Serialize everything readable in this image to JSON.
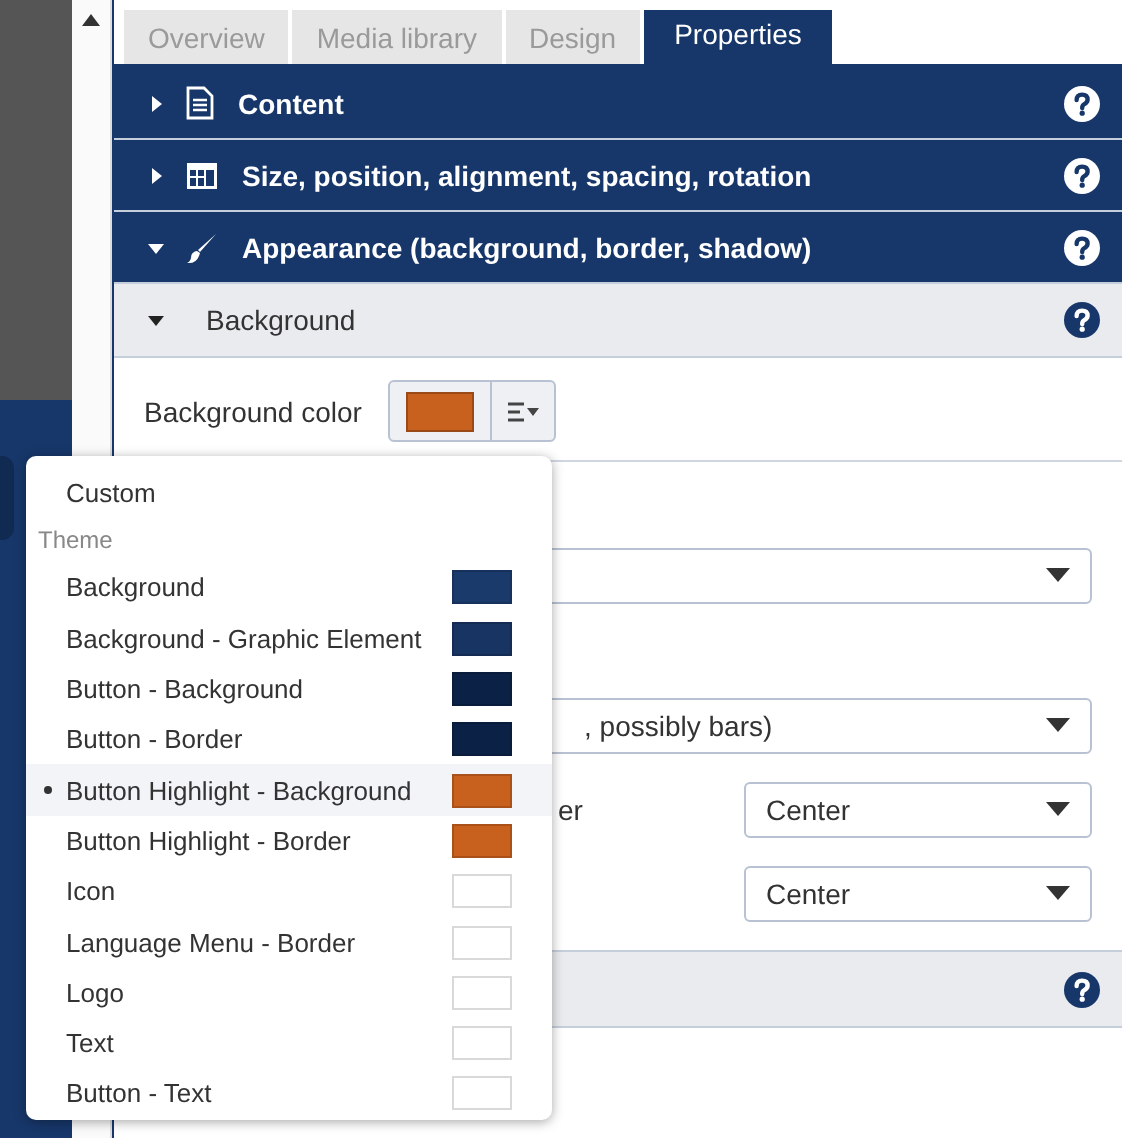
{
  "tabs": [
    {
      "label": "Overview",
      "selected": false
    },
    {
      "label": "Media library",
      "selected": false
    },
    {
      "label": "Design",
      "selected": false
    },
    {
      "label": "Properties",
      "selected": true
    }
  ],
  "sections": [
    {
      "label": "Content",
      "kind": "document",
      "expanded": false
    },
    {
      "label": "Size, position, alignment, spacing, rotation",
      "kind": "grid",
      "expanded": false
    },
    {
      "label": "Appearance (background, border, shadow)",
      "kind": "brush",
      "expanded": true
    }
  ],
  "subsection": {
    "label": "Background",
    "expanded": true
  },
  "background_color": {
    "label": "Background color",
    "color": "#c8601e"
  },
  "fields": [
    {
      "kind": "select"
    },
    {
      "kind": "select",
      "value": ", possibly bars)"
    },
    {
      "kind": "labeled_select",
      "label": "er",
      "value": "Center"
    },
    {
      "kind": "labeled_select",
      "value": "Center"
    }
  ],
  "color_menu": {
    "items": [
      {
        "kind": "option",
        "label": "Custom",
        "selected": false
      },
      {
        "kind": "heading",
        "label": "Theme"
      },
      {
        "kind": "color",
        "label": "Background",
        "color": "#1b3a6c",
        "selected": false
      },
      {
        "kind": "color",
        "label": "Background - Graphic Element",
        "color": "#183463",
        "selected": false
      },
      {
        "kind": "color",
        "label": "Button - Background",
        "color": "#0b2146",
        "selected": false
      },
      {
        "kind": "color",
        "label": "Button - Border",
        "color": "#0b2146",
        "selected": false
      },
      {
        "kind": "color",
        "label": "Button Highlight - Background",
        "color": "#c8601e",
        "selected": true
      },
      {
        "kind": "color",
        "label": "Button Highlight - Border",
        "color": "#c8601e",
        "selected": false
      },
      {
        "kind": "color",
        "label": "Icon",
        "color": "#ffffff",
        "selected": false
      },
      {
        "kind": "color",
        "label": "Language Menu - Border",
        "color": "#ffffff",
        "selected": false
      },
      {
        "kind": "color",
        "label": "Logo",
        "color": "#ffffff",
        "selected": false
      },
      {
        "kind": "color",
        "label": "Text",
        "color": "#ffffff",
        "selected": false
      },
      {
        "kind": "color",
        "label": "Button - Text",
        "color": "#ffffff",
        "selected": false
      }
    ]
  }
}
